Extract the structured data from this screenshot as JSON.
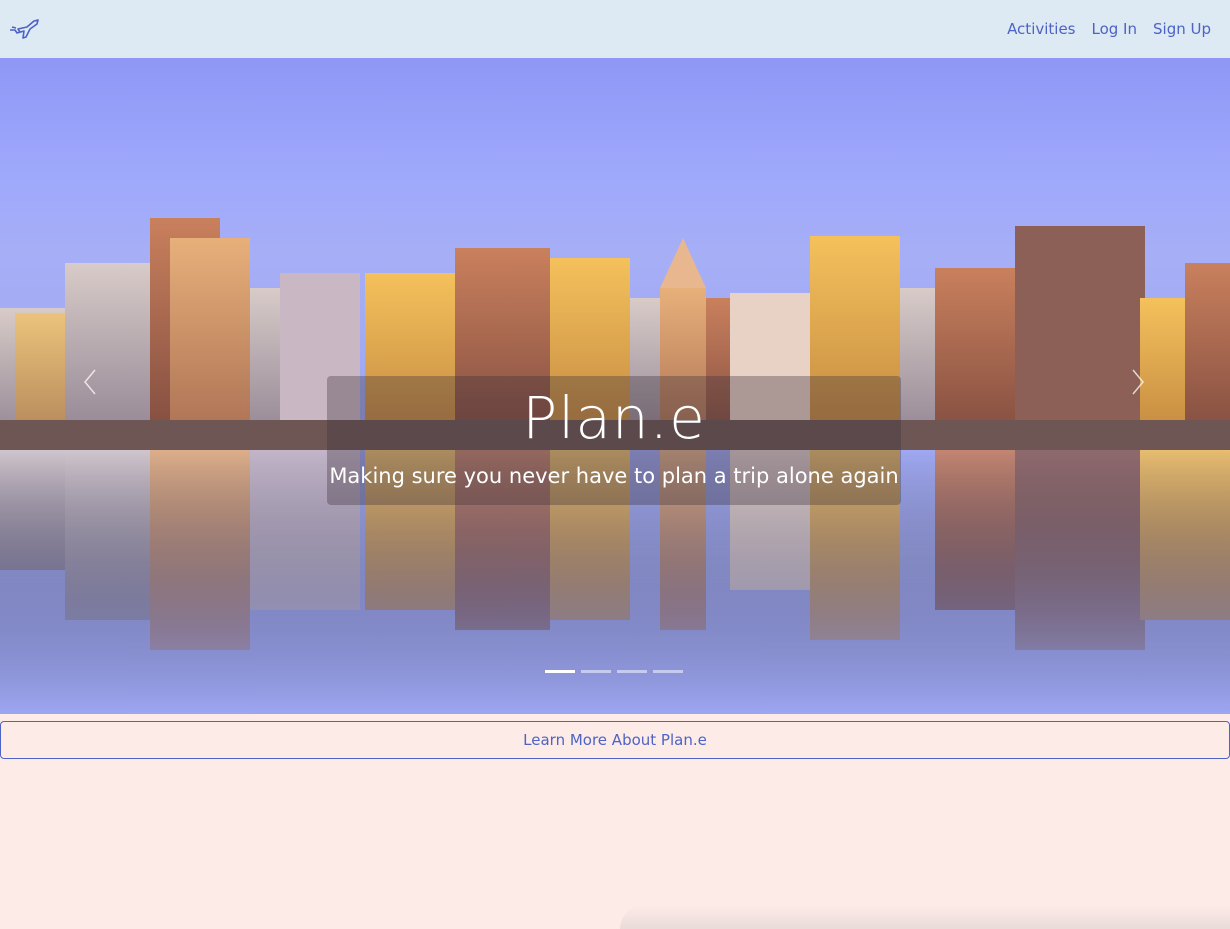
{
  "navbar": {
    "brand_icon": "airplane-icon",
    "links": [
      {
        "label": "Activities"
      },
      {
        "label": "Log In"
      },
      {
        "label": "Sign Up"
      }
    ]
  },
  "hero": {
    "title": "Plan.e",
    "subtitle": "Making sure you never have to plan a trip alone again",
    "prev_icon": "chevron-left-icon",
    "next_icon": "chevron-right-icon",
    "slide_count": 4,
    "active_slide": 1
  },
  "learn_more": {
    "label": "Learn More About Plan.e"
  },
  "colors": {
    "navbar_bg": "#dde9f3",
    "link": "#4d63c6",
    "page_bg": "#fdebe7",
    "sky": "#9ea7f0"
  }
}
